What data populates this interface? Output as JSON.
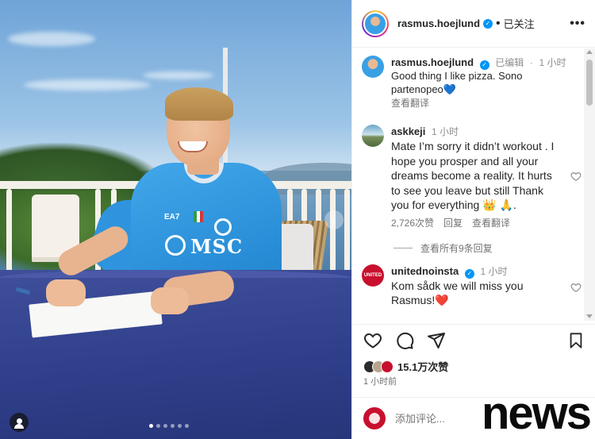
{
  "post": {
    "username": "rasmus.hoejlund",
    "follow_state": "已关注",
    "more_label": "•••",
    "image": {
      "carousel_dots": 6,
      "active_dot": 0,
      "next_arrow": "›",
      "tag_icon": "person-tag-icon"
    }
  },
  "caption": {
    "username": "rasmus.hoejlund",
    "edited": "已编辑",
    "time": "1 小时",
    "text": "Good thing I like pizza. Sono partenopeo💙",
    "translate": "查看翻译"
  },
  "comments": [
    {
      "username": "askkeji",
      "time": "1 小时",
      "text": "Mate I’m sorry it didn’t workout . I hope you prosper and all your dreams become a reality. It hurts to see you leave but still Thank you for everything 👑 🙏.",
      "likes": "2,726次赞",
      "reply": "回复",
      "translate": "查看翻译",
      "view_replies": "查看所有9条回复"
    },
    {
      "username": "unitednoinsta",
      "time": "1 小时",
      "text": "Kom sådk we will miss you Rasmus!❤️"
    }
  ],
  "stats": {
    "likes": "15.1万次赞",
    "time_ago": "1 小时前"
  },
  "composer": {
    "placeholder": "添加评论..."
  },
  "watermark": "news",
  "colors": {
    "verified": "#0095f6",
    "jersey": "#2a8fd8",
    "table": "#2f3f8a"
  }
}
